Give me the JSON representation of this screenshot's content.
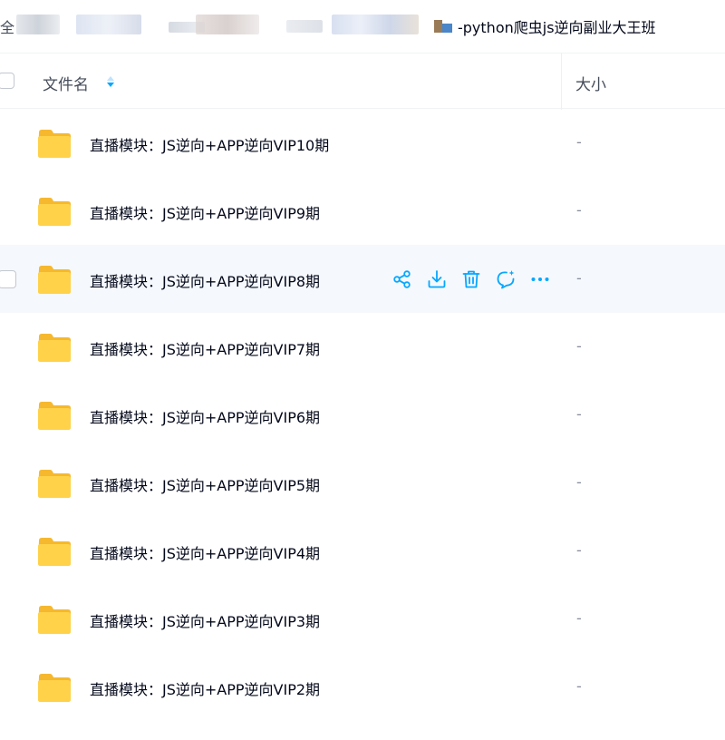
{
  "breadcrumb": {
    "first": "全",
    "current": "-python爬虫js逆向副业大王班"
  },
  "header": {
    "name_label": "文件名",
    "size_label": "大小"
  },
  "colors": {
    "accent": "#06a7ff",
    "folder": "#ffd24a",
    "hover_row": "#f5f8fc"
  },
  "files": [
    {
      "name": "直播模块：JS逆向+APP逆向VIP10期",
      "size": "-",
      "icon": "folder-icon"
    },
    {
      "name": "直播模块：JS逆向+APP逆向VIP9期",
      "size": "-",
      "icon": "folder-icon"
    },
    {
      "name": "直播模块：JS逆向+APP逆向VIP8期",
      "size": "-",
      "icon": "folder-icon"
    },
    {
      "name": "直播模块：JS逆向+APP逆向VIP7期",
      "size": "-",
      "icon": "folder-icon"
    },
    {
      "name": "直播模块：JS逆向+APP逆向VIP6期",
      "size": "-",
      "icon": "folder-icon"
    },
    {
      "name": "直播模块：JS逆向+APP逆向VIP5期",
      "size": "-",
      "icon": "folder-icon"
    },
    {
      "name": "直播模块：JS逆向+APP逆向VIP4期",
      "size": "-",
      "icon": "folder-icon"
    },
    {
      "name": "直播模块：JS逆向+APP逆向VIP3期",
      "size": "-",
      "icon": "folder-icon"
    },
    {
      "name": "直播模块：JS逆向+APP逆向VIP2期",
      "size": "-",
      "icon": "folder-icon"
    }
  ],
  "row_actions": [
    "share-icon",
    "download-icon",
    "delete-icon",
    "ai-chat-icon",
    "more-icon"
  ]
}
